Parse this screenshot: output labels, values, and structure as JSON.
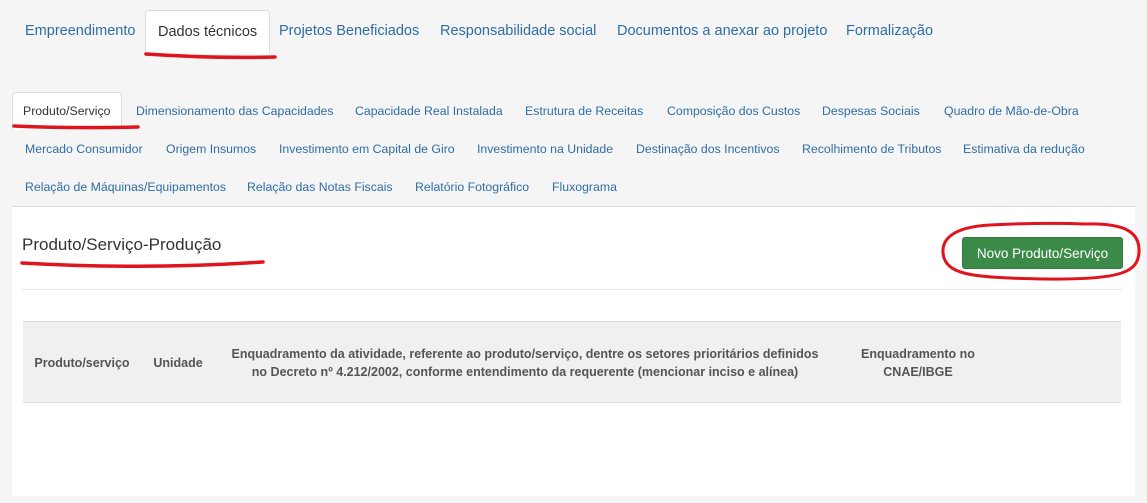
{
  "top_tabs": [
    {
      "label": "Empreendimento"
    },
    {
      "label": "Dados técnicos"
    },
    {
      "label": "Projetos Beneficiados"
    },
    {
      "label": "Responsabilidade social"
    },
    {
      "label": "Documentos a anexar ao projeto"
    },
    {
      "label": "Formalização"
    }
  ],
  "sub_tabs": [
    {
      "label": "Produto/Serviço"
    },
    {
      "label": "Dimensionamento das Capacidades"
    },
    {
      "label": "Capacidade Real Instalada"
    },
    {
      "label": "Estrutura de Receitas"
    },
    {
      "label": "Composição dos Custos"
    },
    {
      "label": "Despesas Sociais"
    },
    {
      "label": "Quadro de Mão-de-Obra"
    },
    {
      "label": "Mercado Consumidor"
    },
    {
      "label": "Origem Insumos"
    },
    {
      "label": "Investimento em Capital de Giro"
    },
    {
      "label": "Investimento na Unidade"
    },
    {
      "label": "Destinação dos Incentivos"
    },
    {
      "label": "Recolhimento de Tributos"
    },
    {
      "label": "Estimativa da redução"
    },
    {
      "label": "Relação de Máquinas/Equipamentos"
    },
    {
      "label": "Relação das Notas Fiscais"
    },
    {
      "label": "Relatório Fotográfico"
    },
    {
      "label": "Fluxograma"
    }
  ],
  "panel": {
    "title": "Produto/Serviço-Produção",
    "new_button": "Novo Produto/Serviço"
  },
  "table": {
    "headers": [
      "Produto/serviço",
      "Unidade",
      "Enquadramento da atividade, referente ao produto/serviço, dentre os setores prioritários definidos no Decreto nº 4.212/2002, conforme entendimento da requerente (mencionar inciso e alínea)",
      "Enquadramento no CNAE/IBGE"
    ]
  },
  "colors": {
    "link": "#2e6da4",
    "button_green": "#3c8a47",
    "annotation_red": "#e0141c"
  }
}
